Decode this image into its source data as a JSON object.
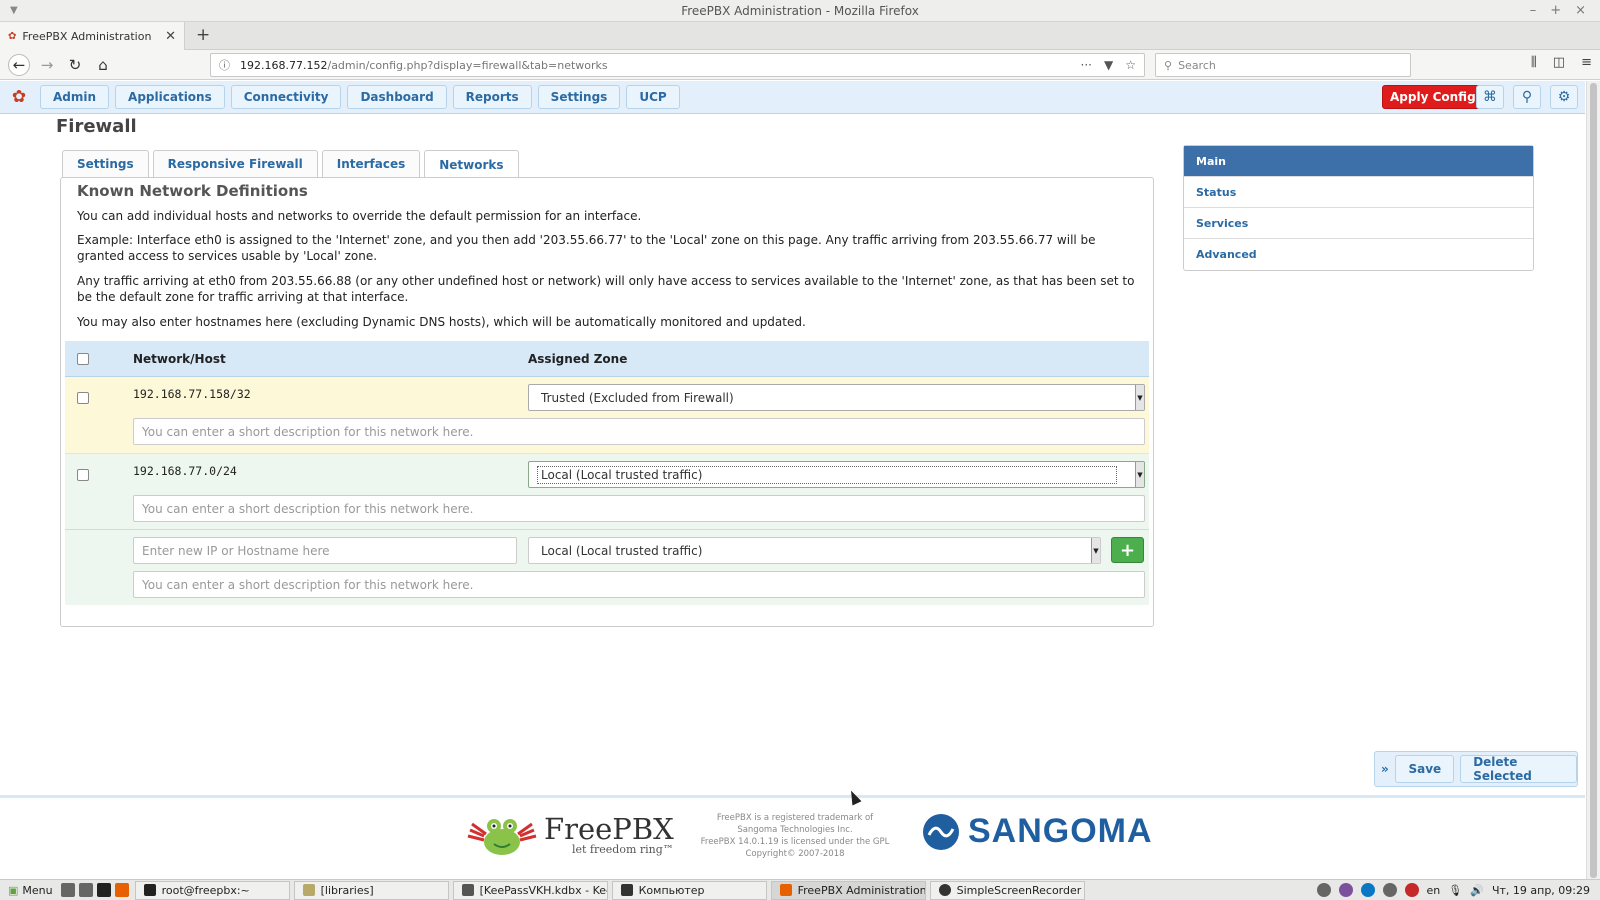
{
  "window": {
    "title": "FreePBX Administration - Mozilla Firefox"
  },
  "browser": {
    "tab_title": "FreePBX Administration",
    "url_host": "192.168.77.152",
    "url_path": "/admin/config.php?display=firewall&tab=networks",
    "search_placeholder": "Search"
  },
  "menu": {
    "items": [
      "Admin",
      "Applications",
      "Connectivity",
      "Dashboard",
      "Reports",
      "Settings",
      "UCP"
    ],
    "apply_config": "Apply Config"
  },
  "page": {
    "title": "Firewall",
    "tabs": [
      "Settings",
      "Responsive Firewall",
      "Interfaces",
      "Networks"
    ],
    "active_tab": "Networks"
  },
  "panel": {
    "heading": "Known Network Definitions",
    "paragraphs": [
      "You can add individual hosts and networks to override the default permission for an interface.",
      "Example: Interface eth0 is assigned to the 'Internet' zone, and you then add '203.55.66.77' to the 'Local' zone on this page. Any traffic arriving from 203.55.66.77 will be granted access to services usable by 'Local' zone.",
      "Any traffic arriving at eth0 from 203.55.66.88 (or any other undefined host or network) will only have access to services available to the 'Internet' zone, as that has been set to be the default zone for traffic arriving at that interface.",
      "You may also enter hostnames here (excluding Dynamic DNS hosts), which will be automatically monitored and updated."
    ],
    "col_network": "Network/Host",
    "col_zone": "Assigned Zone",
    "rows": [
      {
        "network": "192.168.77.158/32",
        "zone": "Trusted (Excluded from Firewall)"
      },
      {
        "network": "192.168.77.0/24",
        "zone": "Local (Local trusted traffic)"
      }
    ],
    "description_placeholder": "You can enter a short description for this network here.",
    "new_row": {
      "ip_placeholder": "Enter new IP or Hostname here",
      "zone": "Local (Local trusted traffic)",
      "description_placeholder": "You can enter a short description for this network here."
    }
  },
  "side_nav": {
    "items": [
      "Main",
      "Status",
      "Services",
      "Advanced"
    ],
    "active": "Main"
  },
  "actions": {
    "expand": "»",
    "save": "Save",
    "delete_selected": "Delete Selected"
  },
  "footer": {
    "freepbx_word": "FreePBX",
    "freepbx_tagline": "let freedom ring™",
    "legal_lines": [
      "FreePBX is a registered trademark of",
      "Sangoma Technologies Inc.",
      "FreePBX 14.0.1.19 is licensed under the GPL",
      "Copyright© 2007-2018"
    ],
    "sangoma_word": "SANGOMA"
  },
  "taskbar": {
    "menu_label": "Menu",
    "tasks": [
      "root@freepbx:~",
      "[libraries]",
      "[KeePassVKH.kdbx - KeeP...",
      "Компьютер",
      "FreePBX Administration - ...",
      "SimpleScreenRecorder"
    ],
    "active_task": "FreePBX Administration - ...",
    "lang": "en",
    "clock": "Чт, 19 апр, 09:29"
  }
}
